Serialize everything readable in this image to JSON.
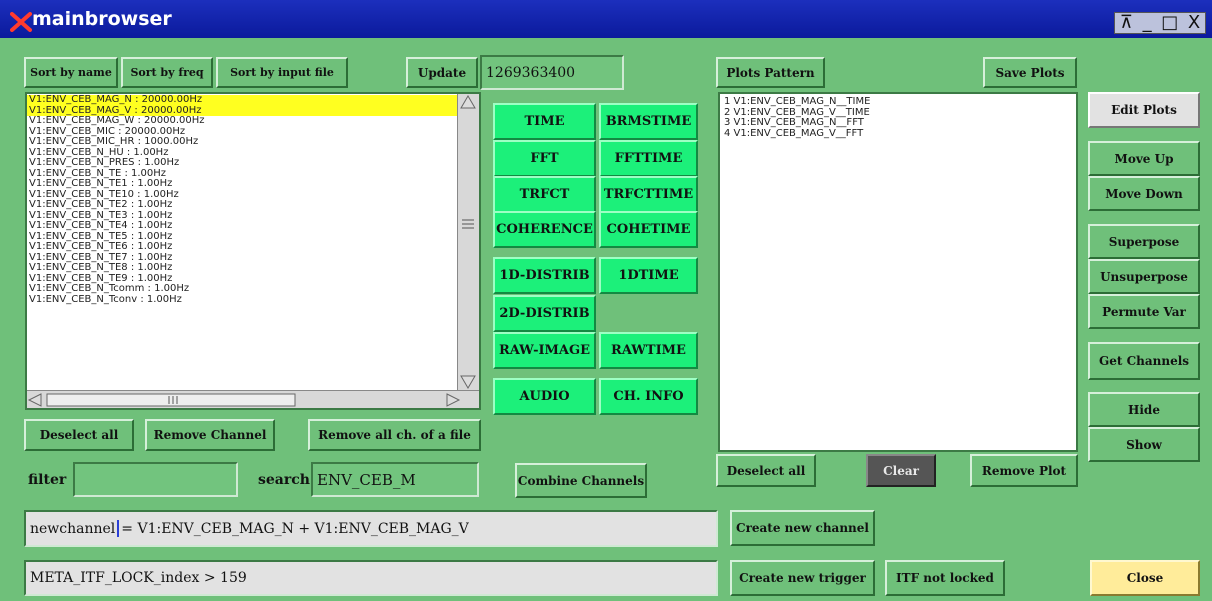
{
  "window": {
    "title": "mainbrowser",
    "controls": [
      "⊼",
      "_",
      "□",
      "X"
    ]
  },
  "top_buttons": {
    "sort_by_name": "Sort by name",
    "sort_by_freq": "Sort by freq",
    "sort_by_input_file": "Sort by input file",
    "update": "Update",
    "gps_time": "1269363400"
  },
  "channels": [
    {
      "label": "V1:ENV_CEB_MAG_N : 20000.00Hz",
      "selected": true
    },
    {
      "label": "V1:ENV_CEB_MAG_V : 20000.00Hz",
      "selected": true
    },
    {
      "label": "V1:ENV_CEB_MAG_W : 20000.00Hz",
      "selected": false
    },
    {
      "label": "V1:ENV_CEB_MIC : 20000.00Hz",
      "selected": false
    },
    {
      "label": "V1:ENV_CEB_MIC_HR : 1000.00Hz",
      "selected": false
    },
    {
      "label": "V1:ENV_CEB_N_HU : 1.00Hz",
      "selected": false
    },
    {
      "label": "V1:ENV_CEB_N_PRES : 1.00Hz",
      "selected": false
    },
    {
      "label": "V1:ENV_CEB_N_TE : 1.00Hz",
      "selected": false
    },
    {
      "label": "V1:ENV_CEB_N_TE1 : 1.00Hz",
      "selected": false
    },
    {
      "label": "V1:ENV_CEB_N_TE10 : 1.00Hz",
      "selected": false
    },
    {
      "label": "V1:ENV_CEB_N_TE2 : 1.00Hz",
      "selected": false
    },
    {
      "label": "V1:ENV_CEB_N_TE3 : 1.00Hz",
      "selected": false
    },
    {
      "label": "V1:ENV_CEB_N_TE4 : 1.00Hz",
      "selected": false
    },
    {
      "label": "V1:ENV_CEB_N_TE5 : 1.00Hz",
      "selected": false
    },
    {
      "label": "V1:ENV_CEB_N_TE6 : 1.00Hz",
      "selected": false
    },
    {
      "label": "V1:ENV_CEB_N_TE7 : 1.00Hz",
      "selected": false
    },
    {
      "label": "V1:ENV_CEB_N_TE8 : 1.00Hz",
      "selected": false
    },
    {
      "label": "V1:ENV_CEB_N_TE9 : 1.00Hz",
      "selected": false
    },
    {
      "label": "V1:ENV_CEB_N_Tcomm : 1.00Hz",
      "selected": false
    },
    {
      "label": "V1:ENV_CEB_N_Tconv : 1.00Hz",
      "selected": false
    }
  ],
  "channel_actions": {
    "deselect_all": "Deselect all",
    "remove_channel": "Remove Channel",
    "remove_all_file": "Remove all ch. of a file"
  },
  "filter": {
    "label": "filter",
    "value": ""
  },
  "search": {
    "label": "search",
    "value": "ENV_CEB_M"
  },
  "plot_types": {
    "time": "TIME",
    "brmstime": "BRMSTIME",
    "fft": "FFT",
    "ffttime": "FFTTIME",
    "trfct": "TRFCT",
    "trfcttime": "TRFCTTIME",
    "coherence": "COHERENCE",
    "cohetime": "COHETIME",
    "distrib1d": "1D-DISTRIB",
    "time1d": "1DTIME",
    "distrib2d": "2D-DISTRIB",
    "rawimage": "RAW-IMAGE",
    "rawtime": "RAWTIME",
    "audio": "AUDIO",
    "chinfo": "CH. INFO"
  },
  "combine_channels": "Combine Channels",
  "plots": {
    "pattern_label": "Plots Pattern",
    "save_label": "Save Plots",
    "items": [
      "1  V1:ENV_CEB_MAG_N__TIME",
      "2  V1:ENV_CEB_MAG_V__TIME",
      "3  V1:ENV_CEB_MAG_N__FFT",
      "4  V1:ENV_CEB_MAG_V__FFT"
    ],
    "deselect_all": "Deselect all",
    "clear": "Clear",
    "remove_plot": "Remove Plot"
  },
  "side_buttons": {
    "edit_plots": "Edit Plots",
    "move_up": "Move Up",
    "move_down": "Move Down",
    "superpose": "Superpose",
    "unsuperpose": "Unsuperpose",
    "permute_var": "Permute Var",
    "get_channels": "Get Channels",
    "hide": "Hide",
    "show": "Show",
    "close": "Close"
  },
  "newchannel": {
    "label": "newchannel",
    "expr": "= V1:ENV_CEB_MAG_N + V1:ENV_CEB_MAG_V",
    "create_label": "Create new channel"
  },
  "trigger": {
    "value": "META_ITF_LOCK_index > 159",
    "create_label": "Create new trigger",
    "itf_label": "ITF not locked"
  },
  "colors": {
    "background": "#6fc07a",
    "title_bar": "#1c2fbd",
    "plot_button": "#1cf07a",
    "selection": "#ffff20",
    "clear_button": "#555555",
    "close_button": "#ffec9a"
  }
}
